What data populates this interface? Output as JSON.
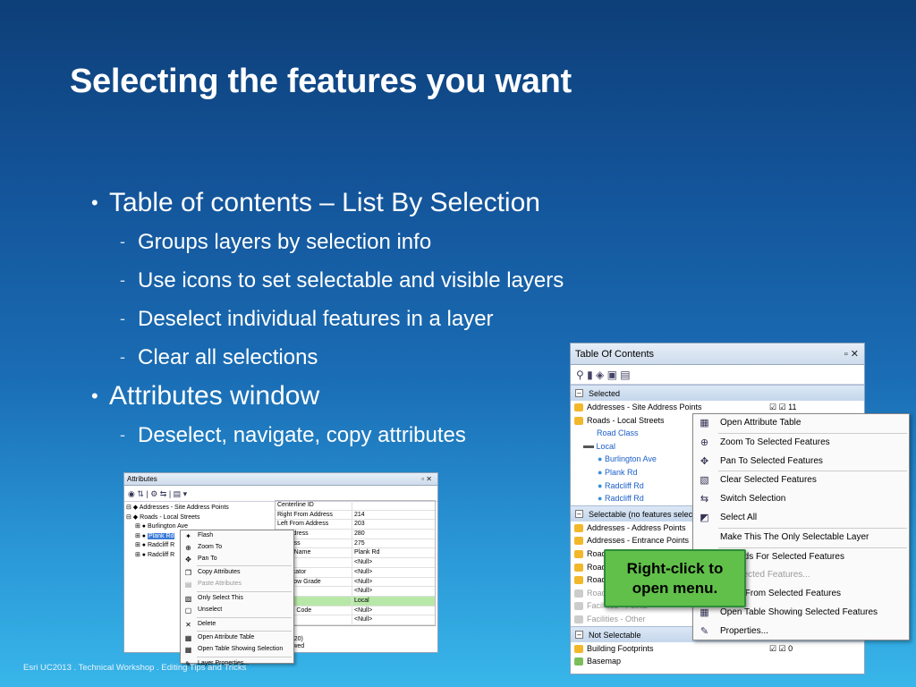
{
  "slide": {
    "title": "Selecting the features you want",
    "footer": "Esri UC2013 . Technical Workshop . Editing Tips and Tricks",
    "bullets": [
      {
        "text": "Table of contents – List By Selection",
        "subs": [
          "Groups layers by selection info",
          "Use icons to set selectable and visible layers",
          "Deselect individual features in a layer",
          "Clear all selections"
        ]
      },
      {
        "text": "Attributes window",
        "subs": [
          "Deselect, navigate, copy attributes"
        ]
      }
    ]
  },
  "attributes_window": {
    "title": "Attributes",
    "tree": [
      "Addresses - Site Address Points",
      "Roads - Local Streets",
      "Burlington Ave",
      "Plank Rd",
      "Radcliff R",
      "Radcliff R"
    ],
    "grid": [
      [
        "Centerline ID",
        ""
      ],
      [
        "Right From Address",
        "214"
      ],
      [
        "Left From Address",
        "203"
      ],
      [
        "To Address",
        "280"
      ],
      [
        "Address",
        "275"
      ],
      [
        "Road Name",
        "Plank Rd"
      ],
      [
        "Route",
        "<Null>"
      ],
      [
        "y Indicator",
        "<Null>"
      ],
      [
        "or Below Grade",
        "<Null>"
      ],
      [
        "",
        "<Null>"
      ],
      [
        "lass",
        "Local"
      ],
      [
        "CFCC Code",
        "<Null>"
      ],
      [
        "By",
        "<Null>"
      ]
    ],
    "desc": [
      "e ID",
      "gth = 20)",
      "s allowed"
    ],
    "menu": [
      {
        "label": "Flash",
        "icon": "flash-icon",
        "glyph": "✦"
      },
      {
        "label": "Zoom To",
        "icon": "zoom-to-icon",
        "glyph": "⊕"
      },
      {
        "label": "Pan To",
        "icon": "pan-to-icon",
        "glyph": "✥"
      },
      {
        "label": "Copy Attributes",
        "icon": "copy-icon",
        "glyph": "❐"
      },
      {
        "label": "Paste Attributes",
        "icon": "paste-icon",
        "glyph": "▤"
      },
      {
        "label": "Only Select This",
        "icon": "select-icon",
        "glyph": "▧"
      },
      {
        "label": "Unselect",
        "icon": "unselect-icon",
        "glyph": "▢"
      },
      {
        "label": "Delete",
        "icon": "delete-icon",
        "glyph": "✕"
      },
      {
        "label": "Open Attribute Table",
        "icon": "table-icon",
        "glyph": "▦"
      },
      {
        "label": "Open Table Showing Selection",
        "icon": "table-selection-icon",
        "glyph": "▦"
      },
      {
        "label": "Layer Properties...",
        "icon": "properties-icon",
        "glyph": "✎"
      }
    ]
  },
  "toc_window": {
    "title": "Table Of Contents",
    "groups": {
      "selected": "Selected",
      "selectable": "Selectable (no features selec",
      "not_selectable": "Not Selectable"
    },
    "selected_layers": [
      "Addresses - Site Address Points",
      "Roads - Local Streets"
    ],
    "selected_count": "11",
    "road_class": "Road Class",
    "local": "Local",
    "roads": [
      "Burlington Ave",
      "Plank Rd",
      "Radcliff Rd",
      "Radcliff Rd"
    ],
    "selectable_layers": [
      "Addresses - Address Points",
      "Addresses - Entrance Points",
      "Road",
      "Road",
      "Road",
      "Road",
      "Facilities - Points",
      "Facilities - Other"
    ],
    "not_selectable_layers": [
      "Building Footprints",
      "Basemap"
    ],
    "building_count": "0",
    "menu": [
      {
        "label": "Open Attribute Table",
        "icon": "table-icon",
        "glyph": "▦"
      },
      {
        "label": "Zoom To Selected Features",
        "icon": "zoom-selected-icon",
        "glyph": "⊕"
      },
      {
        "label": "Pan To Selected Features",
        "icon": "pan-selected-icon",
        "glyph": "✥"
      },
      {
        "label": "Clear Selected Features",
        "icon": "clear-selection-icon",
        "glyph": "▧"
      },
      {
        "label": "Switch Selection",
        "icon": "switch-selection-icon",
        "glyph": "⇆"
      },
      {
        "label": "Select All",
        "icon": "select-all-icon",
        "glyph": "◩"
      },
      {
        "label": "Make This The Only Selectable Layer",
        "icon": "",
        "glyph": ""
      },
      {
        "label": "Records For Selected Features",
        "icon": "",
        "glyph": ""
      },
      {
        "label": "te Selected Features...",
        "icon": "",
        "glyph": ""
      },
      {
        "label": "Layer From Selected Features",
        "icon": "",
        "glyph": ""
      },
      {
        "label": "Open Table Showing Selected Features",
        "icon": "table-icon",
        "glyph": "▦"
      },
      {
        "label": "Properties...",
        "icon": "properties-icon",
        "glyph": "✎"
      }
    ]
  },
  "callout": {
    "line1": "Right-click to",
    "line2": "open menu."
  }
}
